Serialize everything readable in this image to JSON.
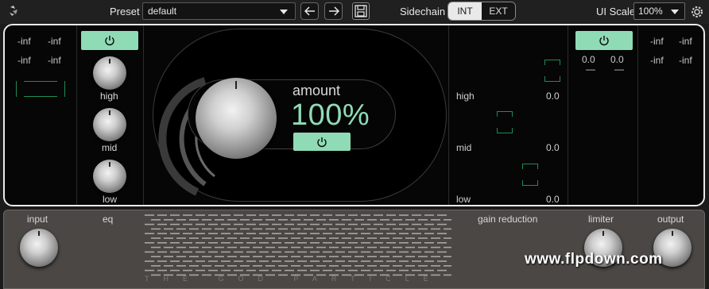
{
  "topbar": {
    "preset_label": "Preset",
    "preset_value": "default",
    "sidechain_label": "Sidechain",
    "sidechain_options": [
      "INT",
      "EXT"
    ],
    "sidechain_selected": "INT",
    "ui_scale_label": "UI Scale",
    "ui_scale_value": "100%"
  },
  "input_meter": {
    "peak": [
      "-inf",
      "-inf"
    ],
    "rms": [
      "-inf",
      "-inf"
    ]
  },
  "eq": {
    "power": "on",
    "bands": [
      {
        "label": "high"
      },
      {
        "label": "mid"
      },
      {
        "label": "low"
      }
    ]
  },
  "amount": {
    "label": "amount",
    "value": "100%",
    "power": "on"
  },
  "gain_reduction": {
    "bands": [
      {
        "label": "high",
        "value": "0.0"
      },
      {
        "label": "mid",
        "value": "0.0"
      },
      {
        "label": "low",
        "value": "0.0"
      }
    ]
  },
  "limiter": {
    "power": "on",
    "values": [
      "0.0",
      "0.0"
    ],
    "dashes": [
      "—",
      "—"
    ]
  },
  "output_meter": {
    "peak": [
      "-inf",
      "-inf"
    ],
    "rms": [
      "-inf",
      "-inf"
    ]
  },
  "bottom": {
    "labels": {
      "input": "input",
      "eq": "eq",
      "gain_reduction": "gain reduction",
      "limiter": "limiter",
      "output": "output"
    },
    "product_name": "THE GOD PARTICLE",
    "watermark": "www.flpdown.com"
  },
  "colors": {
    "accent": "#8fdbb6",
    "meter_green": "#1f8a55",
    "panel_border": "#eaeaea",
    "bottom_panel": "#4a4744"
  },
  "icons": [
    "logo-icon",
    "chevron-down-icon",
    "arrow-left-icon",
    "arrow-right-icon",
    "save-icon",
    "power-icon",
    "gear-icon"
  ]
}
